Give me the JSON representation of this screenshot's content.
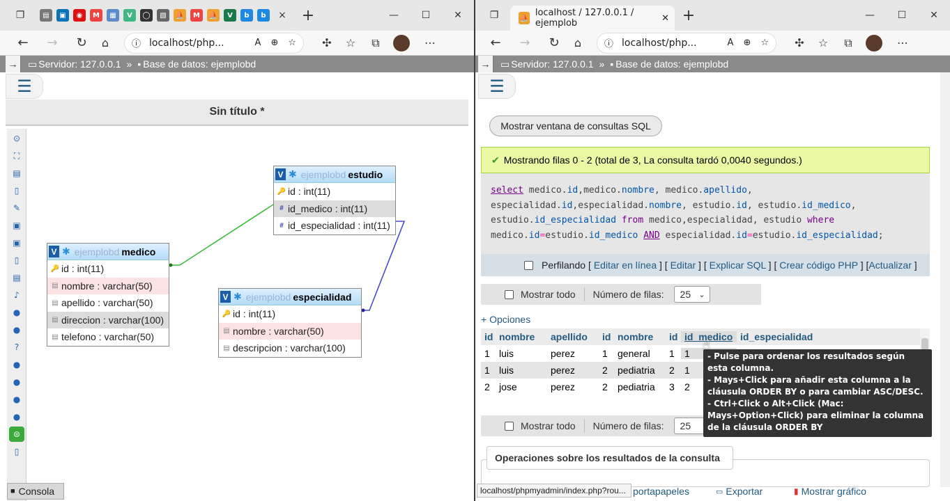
{
  "left": {
    "tabs_close": "×",
    "newtab": "+",
    "address": "localhost/php...",
    "server": "Servidor: 127.0.0.1",
    "sep": "»",
    "database": "Base de datos: ejemplobd",
    "designer_title": "Sin título *",
    "tables": {
      "estudio": {
        "db": "ejemplobd",
        "name": "estudio",
        "fields": [
          "id : int(11)",
          "id_medico : int(11)",
          "id_especialidad : int(11)"
        ]
      },
      "medico": {
        "db": "ejemplobd",
        "name": "medico",
        "fields": [
          "id : int(11)",
          "nombre : varchar(50)",
          "apellido : varchar(50)",
          "direccion : varchar(100)",
          "telefono : varchar(50)"
        ]
      },
      "especialidad": {
        "db": "ejemplobd",
        "name": "especialidad",
        "fields": [
          "id : int(11)",
          "nombre : varchar(50)",
          "descripcion : varchar(100)"
        ]
      }
    },
    "consola": "Consola"
  },
  "right": {
    "tab_title": "localhost / 127.0.0.1 / ejemplob",
    "address": "localhost/php...",
    "server": "Servidor: 127.0.0.1",
    "sep": "»",
    "database": "Base de datos: ejemplobd",
    "sql_window_btn": "Mostrar ventana de consultas SQL",
    "success": "Mostrando filas 0 - 2 (total de 3, La consulta tardó 0,0040 segundos.)",
    "profiling": "Perfilando",
    "links": [
      "Editar en línea",
      "Editar",
      "Explicar SQL",
      "Crear código PHP",
      "Actualizar"
    ],
    "show_all": "Mostrar todo",
    "rows_label": "Número de filas:",
    "rows_value": "25",
    "options": "+ Opciones",
    "columns": [
      "id",
      "nombre",
      "apellido",
      "id",
      "nombre",
      "id",
      "id_medico",
      "id_especialidad"
    ],
    "rows": [
      [
        "1",
        "luis",
        "perez",
        "1",
        "general",
        "1",
        "1",
        ""
      ],
      [
        "1",
        "luis",
        "perez",
        "2",
        "pediatria",
        "2",
        "1",
        ""
      ],
      [
        "2",
        "jose",
        "perez",
        "2",
        "pediatria",
        "3",
        "2",
        ""
      ]
    ],
    "tooltip": [
      "- Pulse para ordenar los resultados según esta columna.",
      "- Mays+Click para añadir esta columna a la cláusula ORDER BY o para cambiar ASC/DESC.",
      "- Ctrl+Click o Alt+Click (Mac: Mays+Option+Click) para eliminar la columna de la cláusula ORDER BY"
    ],
    "ops_title": "Operaciones sobre los resultados de la consulta",
    "status_url": "localhost/phpmyadmin/index.php?rou...",
    "bottom": [
      "portapapeles",
      "Exportar",
      "Mostrar gráfico"
    ]
  }
}
